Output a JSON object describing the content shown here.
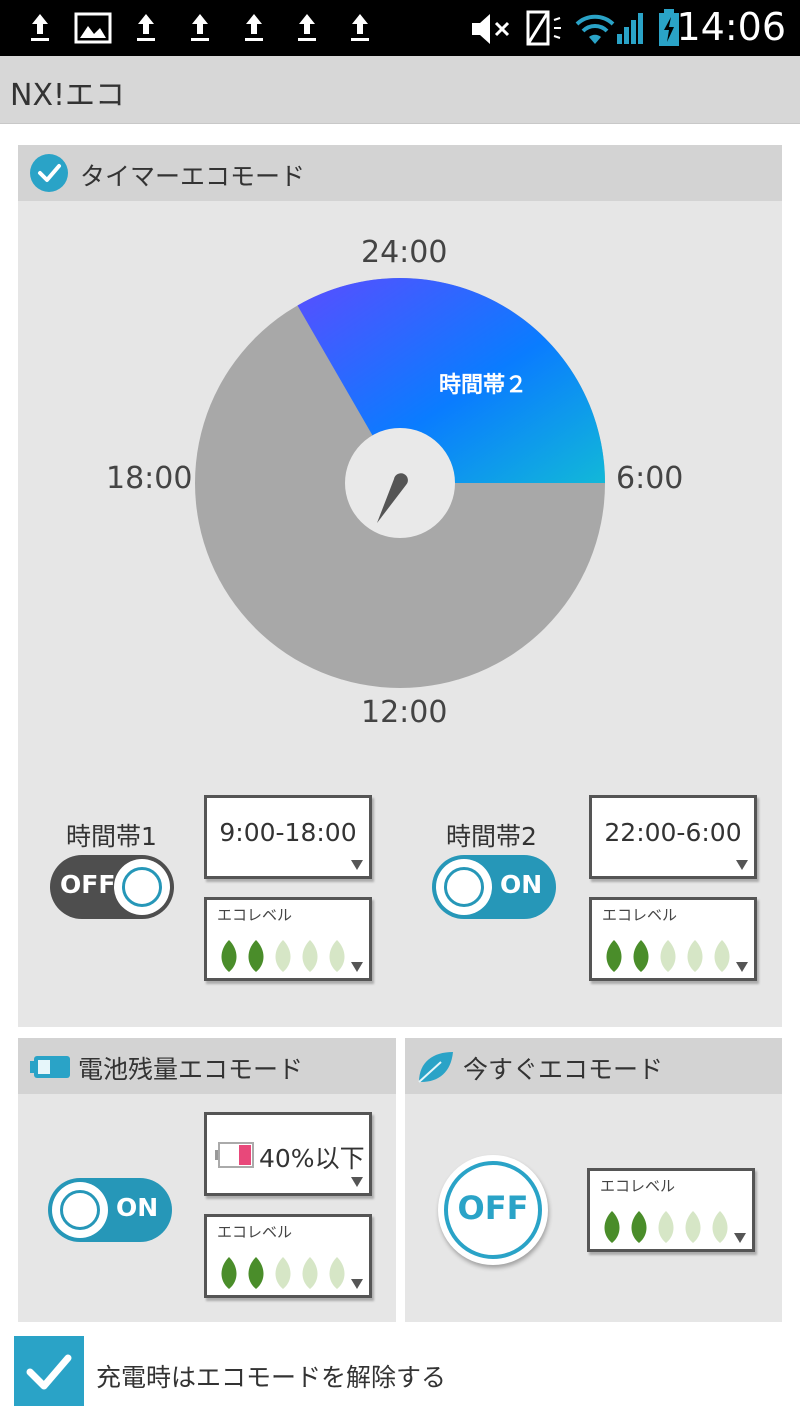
{
  "status_bar": {
    "time": "14:06",
    "icons": [
      "upload-icon",
      "image-icon",
      "upload-icon",
      "upload-icon",
      "upload-icon",
      "upload-icon",
      "upload-icon",
      "mute-icon",
      "no-sim-icon",
      "wifi-icon",
      "signal-icon",
      "battery-charging-icon"
    ]
  },
  "app": {
    "title": "NX!エコ"
  },
  "timer_mode": {
    "title": "タイマーエコモード",
    "enabled": true,
    "clock": {
      "top_label": "24:00",
      "right_label": "6:00",
      "bottom_label": "12:00",
      "left_label": "18:00",
      "active_slice_label": "時間帯２"
    },
    "band1": {
      "label": "時間帯1",
      "toggle": "OFF",
      "time_range": "9:00-18:00",
      "eco_label": "エコレベル",
      "eco_level": 2,
      "eco_max": 5
    },
    "band2": {
      "label": "時間帯2",
      "toggle": "ON",
      "time_range": "22:00-6:00",
      "eco_label": "エコレベル",
      "eco_level": 2,
      "eco_max": 5
    }
  },
  "battery_mode": {
    "title": "電池残量エコモード",
    "toggle": "ON",
    "threshold": "40%以下",
    "eco_label": "エコレベル",
    "eco_level": 2,
    "eco_max": 5
  },
  "now_mode": {
    "title": "今すぐエコモード",
    "button": "OFF",
    "eco_label": "エコレベル",
    "eco_level": 2,
    "eco_max": 5
  },
  "charge_option": {
    "label": "充電時はエコモードを解除する",
    "checked": true
  },
  "colors": {
    "accent": "#2aa3c7",
    "slice_gray": "#a8a8a8",
    "slice_blue_start": "#5a4dff",
    "slice_blue_end": "#0aa6e8",
    "leaf_active": "#4a8d2a",
    "leaf_inactive": "#d6e6c6"
  }
}
